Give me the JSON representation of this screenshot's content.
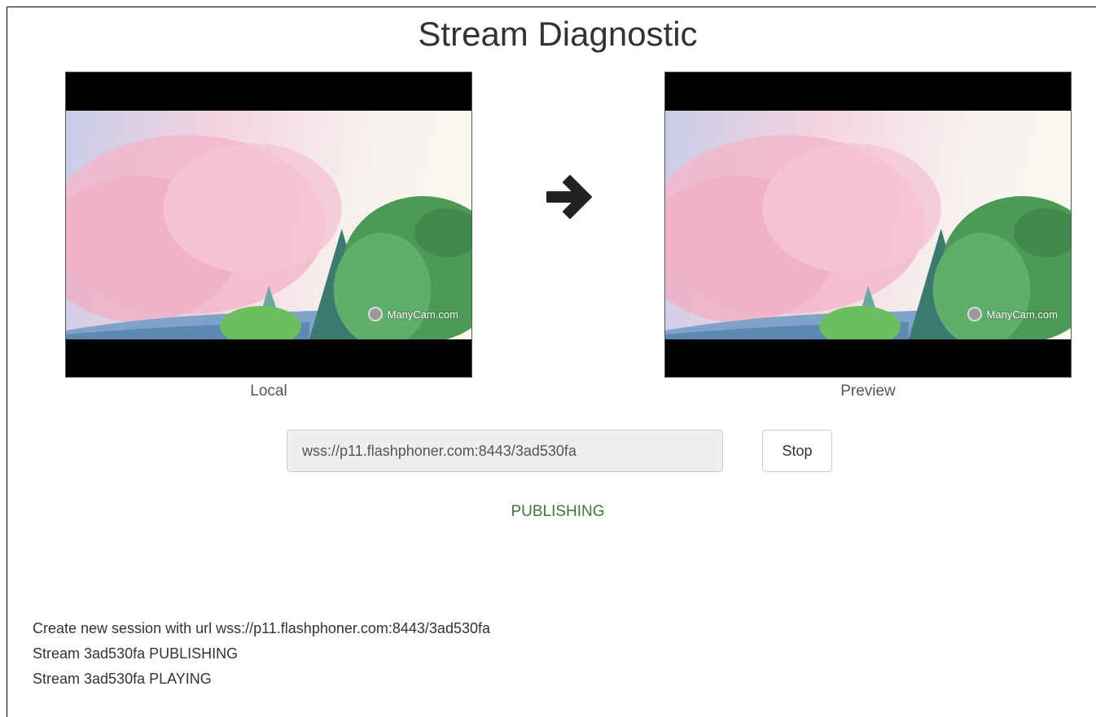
{
  "page": {
    "title": "Stream Diagnostic"
  },
  "videos": {
    "local": {
      "label": "Local",
      "watermark": "ManyCam.com"
    },
    "preview": {
      "label": "Preview",
      "watermark": "ManyCam.com"
    }
  },
  "icons": {
    "arrow": "arrow-right-icon",
    "watermark": "webcam-icon"
  },
  "controls": {
    "url_value": "wss://p11.flashphoner.com:8443/3ad530fa",
    "stop_label": "Stop"
  },
  "status": {
    "text": "PUBLISHING",
    "color": "#3c763d"
  },
  "log": [
    "Create new session with url wss://p11.flashphoner.com:8443/3ad530fa",
    "Stream 3ad530fa PUBLISHING",
    "Stream 3ad530fa PLAYING"
  ]
}
